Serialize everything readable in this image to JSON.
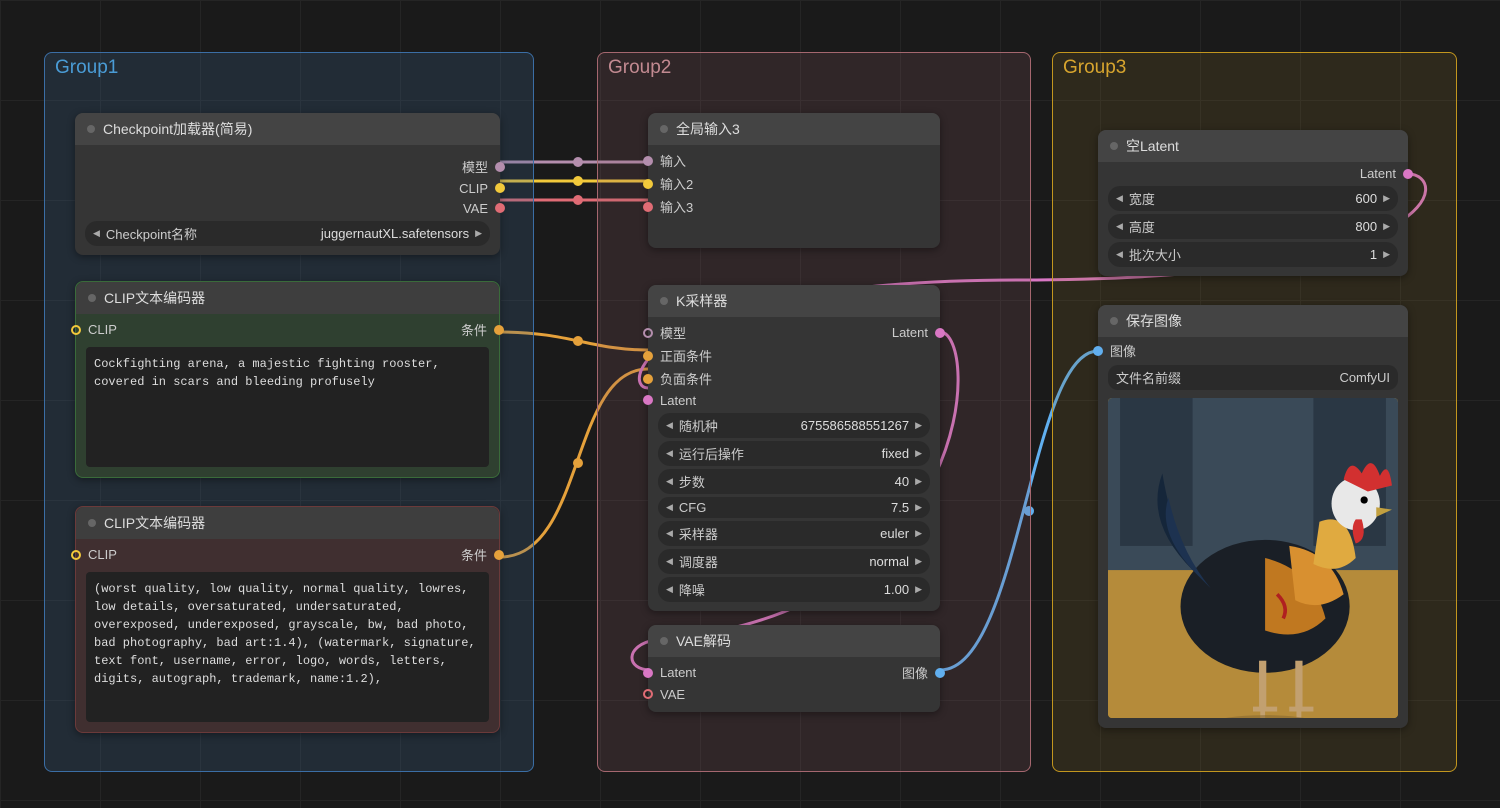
{
  "groups": {
    "g1": {
      "title": "Group1"
    },
    "g2": {
      "title": "Group2"
    },
    "g3": {
      "title": "Group3"
    }
  },
  "nodes": {
    "checkpoint": {
      "title": "Checkpoint加载器(简易)",
      "outputs": {
        "model": "模型",
        "clip": "CLIP",
        "vae": "VAE"
      },
      "widget_label": "Checkpoint名称",
      "widget_value": "juggernautXL.safetensors"
    },
    "clip1": {
      "title": "CLIP文本编码器",
      "input": "CLIP",
      "output": "条件",
      "text": "Cockfighting arena, a majestic fighting rooster, covered in scars and bleeding profusely"
    },
    "clip2": {
      "title": "CLIP文本编码器",
      "input": "CLIP",
      "output": "条件",
      "text": "(worst quality, low quality, normal quality, lowres, low details, oversaturated, undersaturated, overexposed, underexposed, grayscale, bw, bad photo, bad photography, bad art:1.4), (watermark, signature, text font, username, error, logo, words, letters, digits, autograph, trademark, name:1.2),"
    },
    "globalin": {
      "title": "全局输入3",
      "inputs": {
        "i1": "输入",
        "i2": "输入2",
        "i3": "输入3"
      }
    },
    "ksampler": {
      "title": "K采样器",
      "inputs": {
        "model": "模型",
        "pos": "正面条件",
        "neg": "负面条件",
        "latent": "Latent"
      },
      "output": "Latent",
      "widgets": [
        {
          "label": "随机种",
          "value": "675586588551267"
        },
        {
          "label": "运行后操作",
          "value": "fixed"
        },
        {
          "label": "步数",
          "value": "40"
        },
        {
          "label": "CFG",
          "value": "7.5"
        },
        {
          "label": "采样器",
          "value": "euler"
        },
        {
          "label": "调度器",
          "value": "normal"
        },
        {
          "label": "降噪",
          "value": "1.00"
        }
      ]
    },
    "vaedec": {
      "title": "VAE解码",
      "inputs": {
        "latent": "Latent",
        "vae": "VAE"
      },
      "output": "图像"
    },
    "emptylatent": {
      "title": "空Latent",
      "output": "Latent",
      "widgets": [
        {
          "label": "宽度",
          "value": "600"
        },
        {
          "label": "高度",
          "value": "800"
        },
        {
          "label": "批次大小",
          "value": "1"
        }
      ]
    },
    "saveimg": {
      "title": "保存图像",
      "input": "图像",
      "widget_label": "文件名前缀",
      "widget_value": "ComfyUI"
    }
  },
  "colors": {
    "purple": "#b48ead",
    "yellow": "#f2c93b",
    "red": "#e06c75",
    "orange": "#e5a13b",
    "pink": "#d977c4",
    "blue": "#61afef"
  }
}
